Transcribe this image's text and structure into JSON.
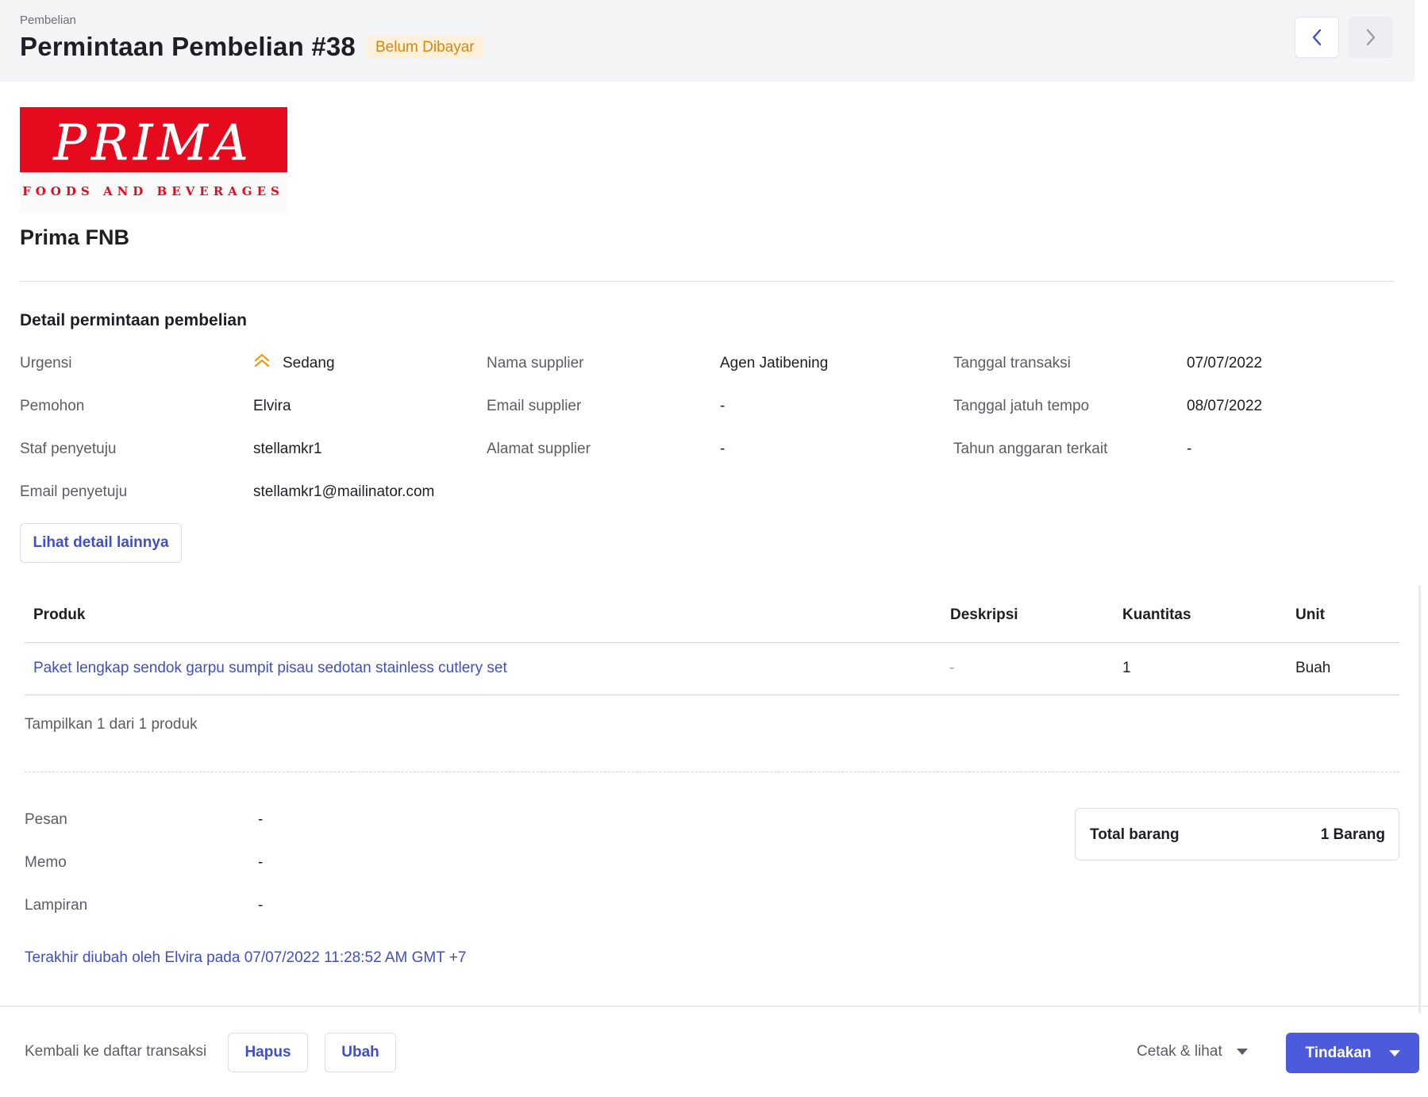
{
  "header": {
    "breadcrumb": "Pembelian",
    "title": "Permintaan Pembelian #38",
    "status_badge": "Belum Dibayar"
  },
  "company": {
    "logo_text": "PRIMA",
    "logo_subtext": "FOODS AND BEVERAGES",
    "name": "Prima FNB"
  },
  "details": {
    "section_title": "Detail permintaan pembelian",
    "urgensi_label": "Urgensi",
    "urgensi_value": "Sedang",
    "pemohon_label": "Pemohon",
    "pemohon_value": "Elvira",
    "staf_label": "Staf penyetuju",
    "staf_value": "stellamkr1",
    "email_penyetuju_label": "Email penyetuju",
    "email_penyetuju_value": "stellamkr1@mailinator.com",
    "nama_supplier_label": "Nama supplier",
    "nama_supplier_value": "Agen Jatibening",
    "email_supplier_label": "Email supplier",
    "email_supplier_value": "-",
    "alamat_supplier_label": "Alamat supplier",
    "alamat_supplier_value": "-",
    "tanggal_transaksi_label": "Tanggal transaksi",
    "tanggal_transaksi_value": "07/07/2022",
    "jatuh_tempo_label": "Tanggal jatuh tempo",
    "jatuh_tempo_value": "08/07/2022",
    "tahun_anggaran_label": "Tahun anggaran terkait",
    "tahun_anggaran_value": "-",
    "more_button": "Lihat detail lainnya"
  },
  "table": {
    "headers": [
      "Produk",
      "Deskripsi",
      "Kuantitas",
      "Unit"
    ],
    "rows": [
      {
        "produk": "Paket lengkap sendok garpu sumpit pisau sedotan stainless cutlery set",
        "deskripsi": "-",
        "kuantitas": "1",
        "unit": "Buah"
      }
    ],
    "showing": "Tampilkan 1 dari 1 produk"
  },
  "notes": {
    "pesan_label": "Pesan",
    "pesan_value": "-",
    "memo_label": "Memo",
    "memo_value": "-",
    "lampiran_label": "Lampiran",
    "lampiran_value": "-"
  },
  "total": {
    "label": "Total barang",
    "value": "1 Barang"
  },
  "last_modified": "Terakhir diubah oleh Elvira pada 07/07/2022 11:28:52 AM GMT +7",
  "footer": {
    "back_link": "Kembali ke daftar transaksi",
    "delete_button": "Hapus",
    "edit_button": "Ubah",
    "print_button": "Cetak & lihat",
    "action_button": "Tindakan"
  },
  "colors": {
    "accent": "#4b5bdb",
    "link": "#3f4fc7",
    "badge_text": "#d9860c",
    "badge_bg": "#fdf1dc",
    "logo_red": "#e60a1e"
  }
}
